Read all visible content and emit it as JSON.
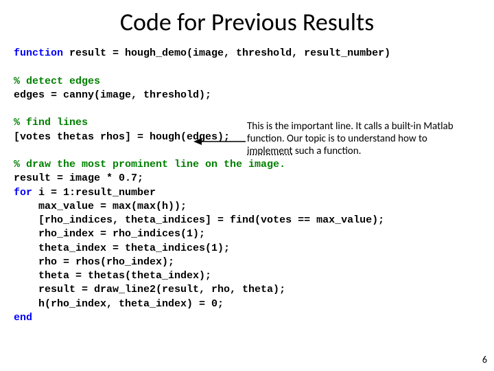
{
  "title": "Code for Previous Results",
  "code": {
    "l1a": "function",
    "l1b": " result = hough_demo(image, threshold, result_number)",
    "l2": "% detect edges",
    "l3": "edges = canny(image, threshold);",
    "l4": "% find lines",
    "l5": "[votes thetas rhos] = hough(edges);",
    "l6": "% draw the most prominent line on the image.",
    "l7": "result = image * 0.7;",
    "l8a": "for",
    "l8b": " i = 1:result_number",
    "l9": "    max_value = max(max(h));",
    "l10": "    [rho_indices, theta_indices] = find(votes == max_value);",
    "l11": "    rho_index = rho_indices(1);",
    "l12": "    theta_index = theta_indices(1);",
    "l13": "    rho = rhos(rho_index);",
    "l14": "    theta = thetas(theta_index);",
    "l15": "    result = draw_line2(result, rho, theta);",
    "l16": "    h(rho_index, theta_index) = 0;",
    "l17": "end"
  },
  "annotation": {
    "part1": "This is the important line. It calls a built-in Matlab function. Our topic is to understand how to ",
    "underlined": "implement",
    "part2": " such a function."
  },
  "page_number": "6"
}
